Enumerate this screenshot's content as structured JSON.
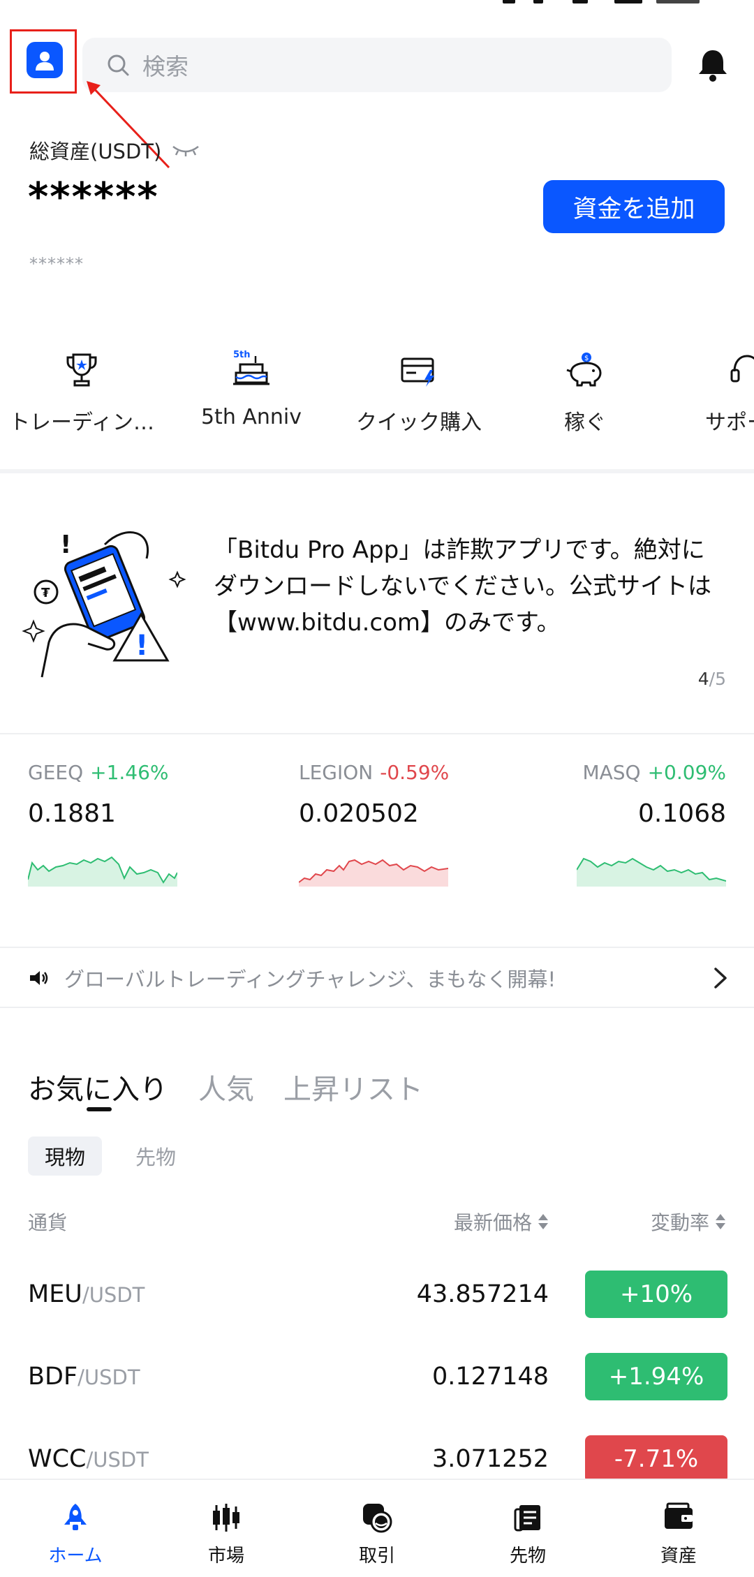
{
  "header": {
    "search_placeholder": "検索",
    "icons": {
      "profile": "profile-icon",
      "search": "search-icon",
      "notifications": "bell-icon"
    }
  },
  "assets": {
    "label": "総資産(USDT)",
    "hidden_value": "******",
    "hidden_sub_value": "******",
    "add_funds_label": "資金を追加"
  },
  "quick_actions": [
    {
      "label": "トレーディン…",
      "icon": "trophy-icon"
    },
    {
      "label": "5th Anniv",
      "icon": "anniversary-cake-icon",
      "badge": "5th"
    },
    {
      "label": "クイック購入",
      "icon": "card-buy-icon"
    },
    {
      "label": "稼ぐ",
      "icon": "piggy-bank-icon"
    },
    {
      "label": "サポート",
      "icon": "support-icon"
    }
  ],
  "banner": {
    "text": "「Bitdu Pro App」は詐欺アプリです。絶対にダウンロードしないでください。公式サイトは【www.bitdu.com】のみです。",
    "page_current": "4",
    "page_total": "/5"
  },
  "tickers": [
    {
      "symbol": "GEEQ",
      "change": "+1.46%",
      "price": "0.1881",
      "direction": "up"
    },
    {
      "symbol": "LEGION",
      "change": "-0.59%",
      "price": "0.020502",
      "direction": "down"
    },
    {
      "symbol": "MASQ",
      "change": "+0.09%",
      "price": "0.1068",
      "direction": "up"
    }
  ],
  "announcement": {
    "text": "グローバルトレーディングチャレンジ、まもなく開幕!"
  },
  "market": {
    "tabs": [
      "お気に入り",
      "人気",
      "上昇リスト"
    ],
    "subtabs": [
      "現物",
      "先物"
    ],
    "columns": {
      "currency": "通貨",
      "last_price": "最新価格",
      "change": "変動率"
    },
    "rows": [
      {
        "base": "MEU",
        "quote": "/USDT",
        "price": "43.857214",
        "change": "+10%",
        "direction": "up"
      },
      {
        "base": "BDF",
        "quote": "/USDT",
        "price": "0.127148",
        "change": "+1.94%",
        "direction": "up"
      },
      {
        "base": "WCC",
        "quote": "/USDT",
        "price": "3.071252",
        "change": "-7.71%",
        "direction": "down"
      }
    ]
  },
  "bottom_nav": [
    {
      "label": "ホーム",
      "icon": "home-rocket-icon",
      "active": true
    },
    {
      "label": "市場",
      "icon": "candlestick-icon",
      "active": false
    },
    {
      "label": "取引",
      "icon": "trade-icon",
      "active": false
    },
    {
      "label": "先物",
      "icon": "futures-icon",
      "active": false
    },
    {
      "label": "資産",
      "icon": "wallet-icon",
      "active": false
    }
  ],
  "colors": {
    "brand_blue": "#0a57ff",
    "up_green": "#2ebd72",
    "down_red": "#e0474c",
    "muted_text": "#9a9ea5",
    "annotation_red": "#e8201a"
  }
}
